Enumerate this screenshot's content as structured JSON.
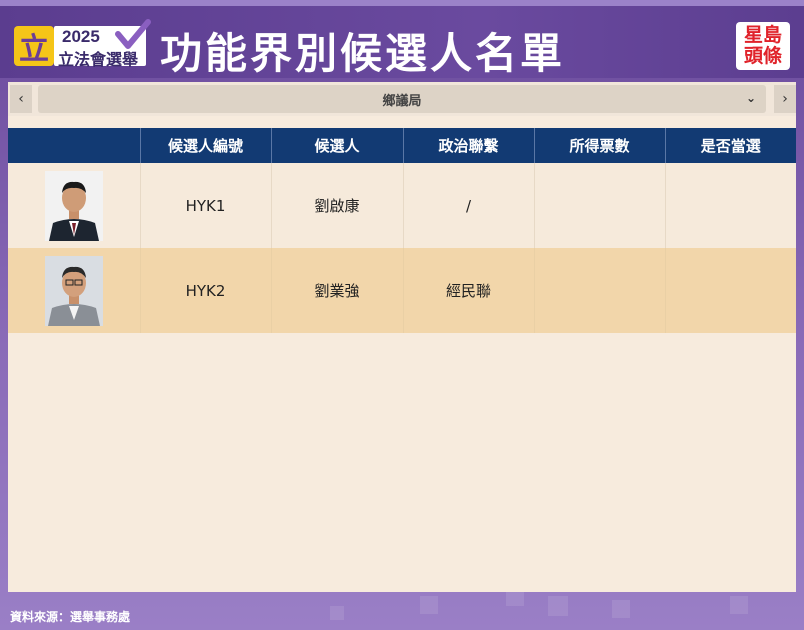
{
  "header": {
    "title": "功能界別候選人名單",
    "logo_glyph": "立",
    "logo_year": "2025",
    "logo_text": "立法會選舉",
    "brand_line1": "星島",
    "brand_line2": "頭條"
  },
  "selector": {
    "prev_label": "‹",
    "next_label": "›",
    "selected": "鄉議局",
    "chevron": "⌄"
  },
  "table": {
    "columns": [
      "",
      "候選人編號",
      "候選人",
      "政治聯繫",
      "所得票數",
      "是否當選"
    ],
    "rows": [
      {
        "number": "HYK1",
        "name": "劉啟康",
        "affiliation": "/",
        "votes": "",
        "elected": ""
      },
      {
        "number": "HYK2",
        "name": "劉業強",
        "affiliation": "經民聯",
        "votes": "",
        "elected": ""
      }
    ]
  },
  "footer": {
    "source": "資料來源：選舉事務處"
  },
  "colors": {
    "header_bg": "#5b3d8f",
    "table_header": "#123a73",
    "row_highlight": "#f2d6aa",
    "panel_bg": "#f7ebdd",
    "brand_red": "#e0222a",
    "logo_yellow": "#f5c518"
  }
}
